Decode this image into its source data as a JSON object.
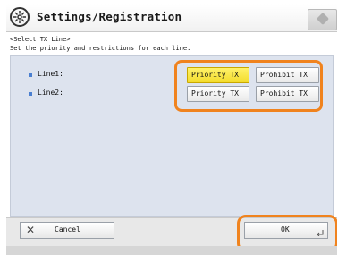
{
  "header": {
    "title": "Settings/Registration",
    "icon": "settings-registration-icon",
    "corner_icon": "counter-check-icon"
  },
  "intro": {
    "line1": "<Select TX Line>",
    "line2": "Set the priority and restrictions for each line."
  },
  "lines": [
    {
      "label": "Line1:",
      "priority_label": "Priority TX",
      "prohibit_label": "Prohibit TX",
      "selected": "priority"
    },
    {
      "label": "Line2:",
      "priority_label": "Priority TX",
      "prohibit_label": "Prohibit TX",
      "selected": "none"
    }
  ],
  "footer": {
    "cancel_label": "Cancel",
    "ok_label": "OK"
  },
  "colors": {
    "selected": "#f3dc2c",
    "highlight": "#f0831e",
    "content_bg": "#dde3ee"
  }
}
